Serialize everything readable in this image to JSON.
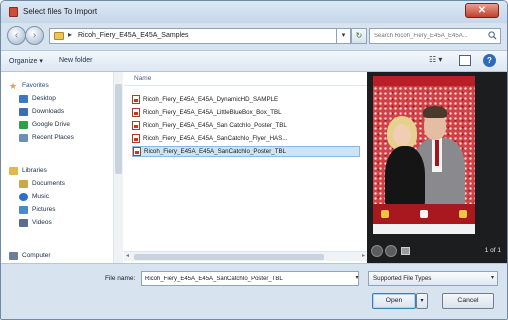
{
  "window": {
    "title": "Select files To Import",
    "close_glyph": "✕"
  },
  "address": {
    "path_arrow": "▸",
    "path": "Ricoh_Fiery_E45A_E45A_Samples",
    "dropdown_glyph": "▾",
    "refresh_glyph": "↻",
    "back_glyph": "‹",
    "forward_glyph": "›"
  },
  "search": {
    "placeholder": "Search Ricoh_Fiery_E45A_E45A..."
  },
  "toolbar": {
    "organize_label": "Organize ▾",
    "new_folder_label": "New folder",
    "views_label": "☷ ▾",
    "help_label": "?"
  },
  "nav": {
    "favorites": "Favorites",
    "items": [
      {
        "label": "Desktop",
        "icon": "desktop-icon",
        "color": "#3b78c4"
      },
      {
        "label": "Downloads",
        "icon": "downloads-icon",
        "color": "#3b6fb3"
      },
      {
        "label": "Google Drive",
        "icon": "google-drive-icon",
        "color": "#2f9e4a"
      },
      {
        "label": "Recent Places",
        "icon": "recent-places-icon",
        "color": "#6c8fb8"
      }
    ],
    "libraries": "Libraries",
    "library_items": [
      {
        "label": "Documents",
        "icon": "documents-icon",
        "color": "#c9a84a"
      },
      {
        "label": "Music",
        "icon": "music-icon",
        "color": "#2d6fcf"
      },
      {
        "label": "Pictures",
        "icon": "pictures-icon",
        "color": "#4a8bc7"
      },
      {
        "label": "Videos",
        "icon": "videos-icon",
        "color": "#5a6d8a"
      }
    ],
    "computer": "Computer"
  },
  "files": {
    "column_name": "Name",
    "items": [
      "Ricoh_Fiery_E45A_E45A_DynamicHD_SAMPLE",
      "Ricoh_Fiery_E45A_E45A_LittleBlueBox_Box_TBL",
      "Ricoh_Fiery_E45A_E45A_San CatchIo_Poster_TBL",
      "Ricoh_Fiery_E45A_E45A_SanCatchIo_Flyer_HAS...",
      "Ricoh_Fiery_E45A_E45A_SanCatchIo_Poster_TBL"
    ],
    "selected_index": 4
  },
  "preview": {
    "page_count": "1 of 1"
  },
  "bottom": {
    "file_name_label": "File name:",
    "file_name_value": "Ricoh_Fiery_E45A_E45A_SanCatchIo_Poster_TBL",
    "file_type": "Supported File Types",
    "dropdown_glyph": "▾",
    "open_label": "Open",
    "open_split_glyph": "▾",
    "cancel_label": "Cancel"
  },
  "colors": {
    "chrome": "#d7e3ef",
    "selection": "#cde3f8",
    "preview_bg": "#1c1d1e",
    "poster_red": "#b81f27"
  }
}
